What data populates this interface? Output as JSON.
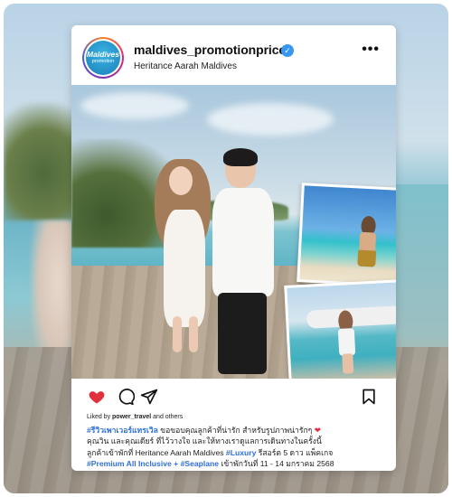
{
  "post": {
    "avatar": {
      "line1": "Maldives",
      "line2": "promotion"
    },
    "username": "maldives_promotionprice",
    "location": "Heritance Aarah Maldives",
    "liked_by_prefix": "Liked by ",
    "liked_by_user": "power_travel",
    "liked_by_suffix": " and others",
    "caption": {
      "tag1": "#รีวิวเพาเวอร์แทรเวิล",
      "text1": " ขอขอบคุณลูกค้าที่น่ารัก สำหรับรูปภาพน่ารักๆ ",
      "heart": "❤",
      "text2": "คุณวิน และคุณเดียร์ ที่ไว้วางใจ และให้ทางเราดูแลการเดินทางในครั้งนี้",
      "text3": "ลูกค้าเข้าพักที่ Heritance Aarah Maldives ",
      "tag2": "#Luxury",
      "text4": " รีสอร์ต 5 ดาว แพ็คเกจ",
      "tag3": "#Premium All Inclusive + #Seaplane",
      "text5": " เข้าพักวันที่ 11 - 14 มกราคม 2568"
    }
  },
  "colors": {
    "hashtag": "#2f6fd6",
    "like_heart": "#e1303d",
    "verified": "#3897f0"
  }
}
